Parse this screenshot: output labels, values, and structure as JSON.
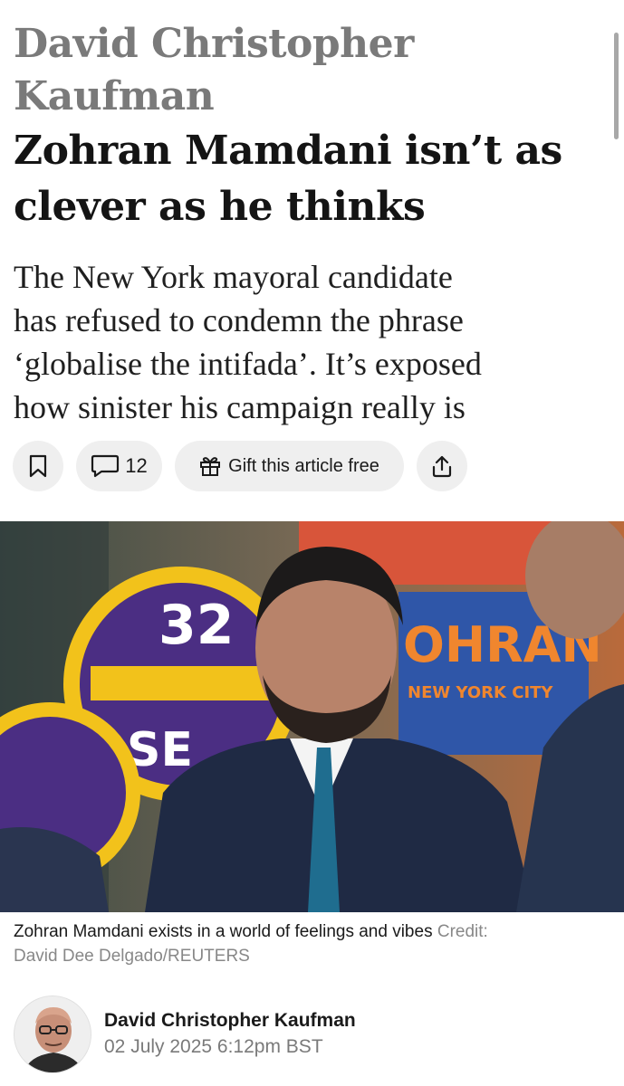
{
  "article": {
    "author_kicker": [
      "David Christopher",
      "Kaufman"
    ],
    "headline": [
      "Zohran Mamdani isn’t as",
      "clever as he thinks"
    ],
    "standfirst": [
      "The New York mayoral candidate",
      "has refused to condemn the phrase",
      "‘globalise the intifada’. It’s exposed",
      "how sinister his campaign really is"
    ]
  },
  "actions": {
    "bookmark_icon": "bookmark-icon",
    "comment_icon": "comment-icon",
    "comment_count": "12",
    "gift_icon": "gift-icon",
    "gift_label": "Gift this article free",
    "share_icon": "share-icon"
  },
  "photo": {
    "sign_left_text": "32",
    "sign_left_lower": "SE",
    "sign_right_text": "OHRAN",
    "sign_right_sub": "NEW YORK CITY"
  },
  "caption": {
    "text": "Zohran Mamdani exists in a world of feelings and vibes",
    "credit_label": "Credit:",
    "credit": "David Dee Delgado/REUTERS"
  },
  "byline": {
    "name": "David Christopher Kaufman",
    "date": "02 July 2025 6:12pm BST"
  },
  "colors": {
    "kicker": "#7a7a7a",
    "headline": "#141414",
    "pill_bg": "#efefef",
    "sign_purple": "#4b2e83",
    "sign_yellow": "#f2c21b"
  }
}
